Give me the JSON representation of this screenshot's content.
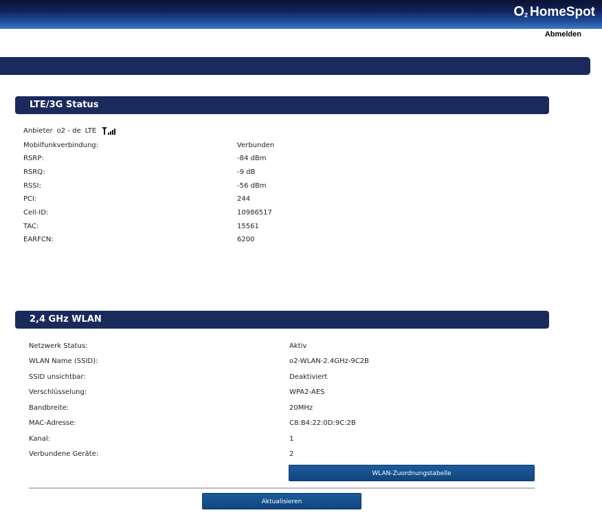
{
  "header": {
    "brand_o": "O",
    "brand_sub": "2",
    "brand_name": "HomeSpot",
    "logout_label": "Abmelden"
  },
  "lte": {
    "title": "LTE/3G Status",
    "provider_label": "Anbieter",
    "provider_name": "o2 - de",
    "network_type": "LTE",
    "rows": [
      {
        "label": "Mobilfunkverbindung:",
        "value": "Verbunden"
      },
      {
        "label": "RSRP:",
        "value": "-84 dBm"
      },
      {
        "label": "RSRQ:",
        "value": "-9 dB"
      },
      {
        "label": "RSSI:",
        "value": "-56 dBm"
      },
      {
        "label": "PCI:",
        "value": "244"
      },
      {
        "label": "Cell-ID:",
        "value": "10986517"
      },
      {
        "label": "TAC:",
        "value": "15561"
      },
      {
        "label": "EARFCN:",
        "value": "6200"
      }
    ]
  },
  "wlan": {
    "title": "2,4 GHz WLAN",
    "rows": [
      {
        "label": "Netzwerk Status:",
        "value": "Aktiv"
      },
      {
        "label": "WLAN Name (SSID):",
        "value": "o2-WLAN-2.4GHz-9C2B"
      },
      {
        "label": "SSID unsichtbar:",
        "value": "Deaktiviert"
      },
      {
        "label": "Verschlüsselung:",
        "value": "WPA2-AES"
      },
      {
        "label": "Bandbreite:",
        "value": "20MHz"
      },
      {
        "label": "MAC-Adresse:",
        "value": "C8:B4:22:0D:9C:2B"
      },
      {
        "label": "Kanal:",
        "value": "1"
      },
      {
        "label": "Verbundene Geräte:",
        "value": "2"
      }
    ],
    "table_button": "WLAN-Zuordnungstabelle"
  },
  "refresh_button": "Aktualisieren"
}
